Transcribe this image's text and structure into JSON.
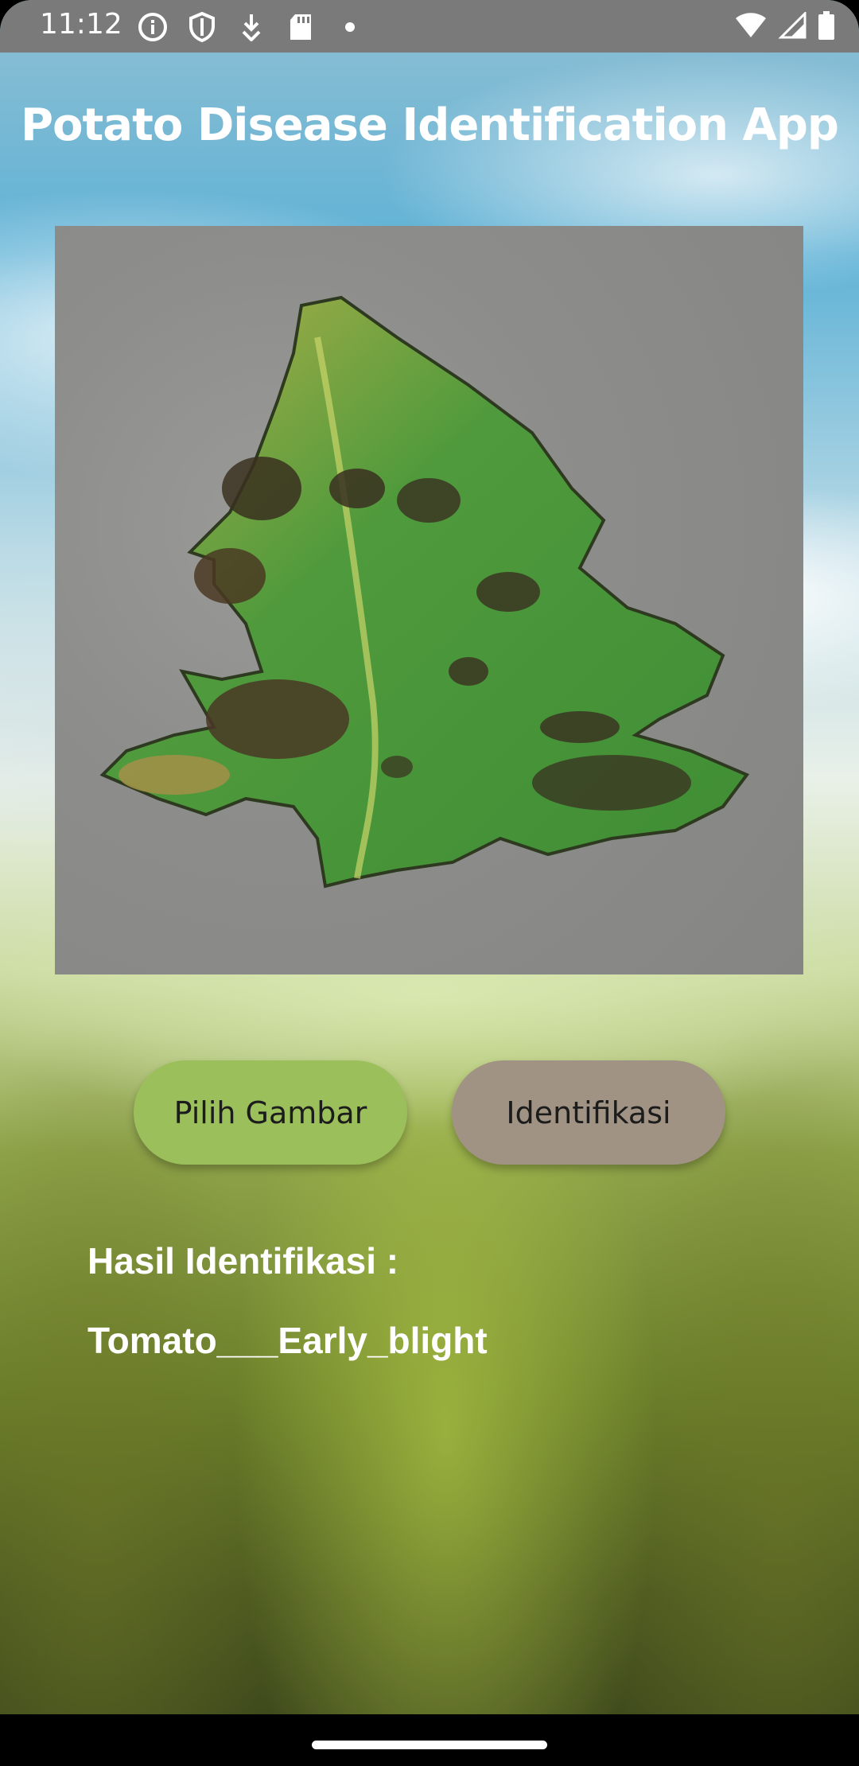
{
  "status_bar": {
    "time": "11:12",
    "left_icons": [
      "info-icon",
      "shield-icon",
      "download-icon",
      "sd-card-icon",
      "dot-icon"
    ],
    "right_icons": [
      "wifi-icon",
      "signal-icon",
      "battery-icon"
    ]
  },
  "app": {
    "title": "Potato Disease Identification App"
  },
  "buttons": {
    "pick_label": "Pilih Gambar",
    "identify_label": "Identifikasi",
    "pick_color": "#9bbf5b",
    "identify_color": "#a09383"
  },
  "result": {
    "label": "Hasil Identifikasi :",
    "value": "Tomato___Early_blight"
  }
}
